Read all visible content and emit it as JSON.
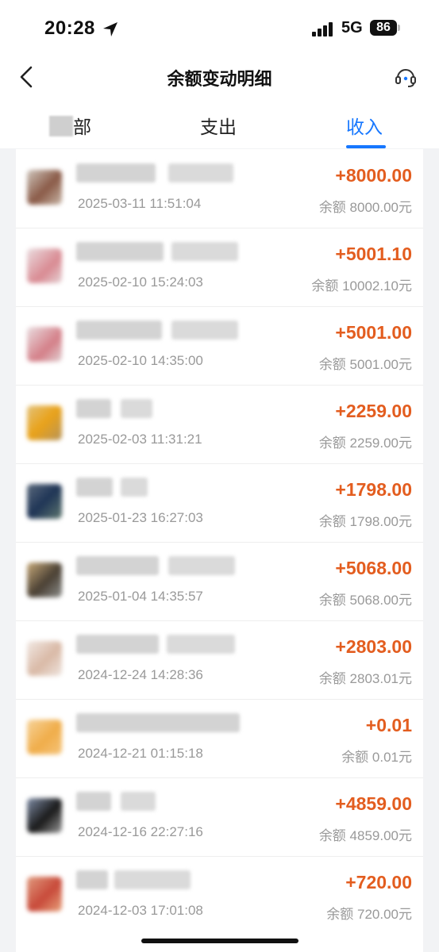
{
  "status_bar": {
    "time": "20:28",
    "network": "5G",
    "battery": "86"
  },
  "nav": {
    "title": "余额变动明细"
  },
  "tabs": [
    {
      "label": "部"
    },
    {
      "label": "支出"
    },
    {
      "label": "收入"
    }
  ],
  "colors": {
    "accent": "#1677ff",
    "amount": "#e35d1f"
  },
  "records": [
    {
      "date": "2025-03-11 11:51:04",
      "amount": "+8000.00",
      "balance": "余额 8000.00元"
    },
    {
      "date": "2025-02-10 15:24:03",
      "amount": "+5001.10",
      "balance": "余额 10002.10元"
    },
    {
      "date": "2025-02-10 14:35:00",
      "amount": "+5001.00",
      "balance": "余额 5001.00元"
    },
    {
      "date": "2025-02-03 11:31:21",
      "amount": "+2259.00",
      "balance": "余额 2259.00元"
    },
    {
      "date": "2025-01-23 16:27:03",
      "amount": "+1798.00",
      "balance": "余额 1798.00元"
    },
    {
      "date": "2025-01-04 14:35:57",
      "amount": "+5068.00",
      "balance": "余额 5068.00元"
    },
    {
      "date": "2024-12-24 14:28:36",
      "amount": "+2803.00",
      "balance": "余额 2803.01元"
    },
    {
      "date": "2024-12-21 01:15:18",
      "amount": "+0.01",
      "balance": "余额 0.01元"
    },
    {
      "date": "2024-12-16 22:27:16",
      "amount": "+4859.00",
      "balance": "余额 4859.00元"
    },
    {
      "date": "2024-12-03 17:01:08",
      "amount": "+720.00",
      "balance": "余额 720.00元"
    }
  ]
}
